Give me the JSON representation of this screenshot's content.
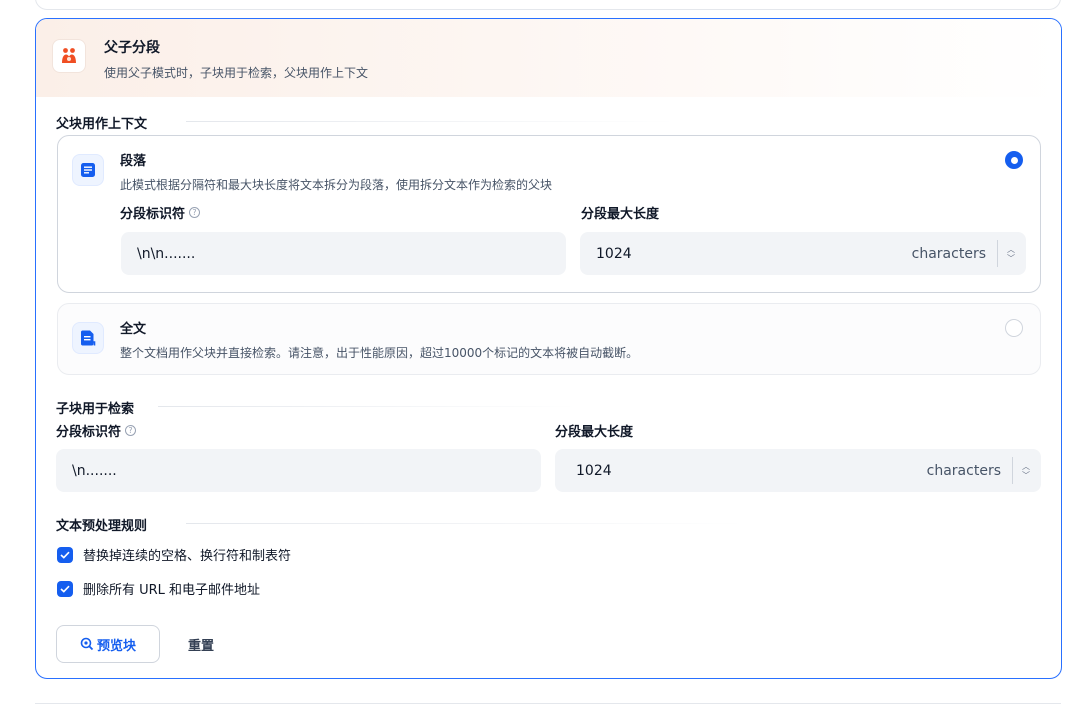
{
  "header": {
    "title": "父子分段",
    "description": "使用父子模式时，子块用于检索，父块用作上下文",
    "icon": "parent-child-icon"
  },
  "parent_section": {
    "title": "父块用作上下文",
    "options": [
      {
        "title": "段落",
        "description": "此模式根据分隔符和最大块长度将文本拆分为段落，使用拆分文本作为检索的父块",
        "selected": true,
        "icon": "paragraph-icon",
        "separator_label": "分段标识符",
        "separator_value": "\\n\\n.......",
        "max_length_label": "分段最大长度",
        "max_length_value": "1024",
        "max_length_unit": "characters"
      },
      {
        "title": "全文",
        "description": "整个文档用作父块并直接检索。请注意，出于性能原因，超过10000个标记的文本将被自动截断。",
        "selected": false,
        "icon": "document-icon"
      }
    ]
  },
  "child_section": {
    "title": "子块用于检索",
    "separator_label": "分段标识符",
    "separator_value": "\\n.......",
    "max_length_label": "分段最大长度",
    "max_length_value": "1024",
    "max_length_unit": "characters"
  },
  "preprocess": {
    "title": "文本预处理规则",
    "rules": [
      {
        "label": "替换掉连续的空格、换行符和制表符",
        "checked": true
      },
      {
        "label": "删除所有 URL 和电子邮件地址",
        "checked": true
      }
    ]
  },
  "actions": {
    "preview_label": "预览块",
    "reset_label": "重置"
  },
  "colors": {
    "accent": "#155eef",
    "card_border": "#2970ff",
    "header_icon": "#f04e23"
  }
}
